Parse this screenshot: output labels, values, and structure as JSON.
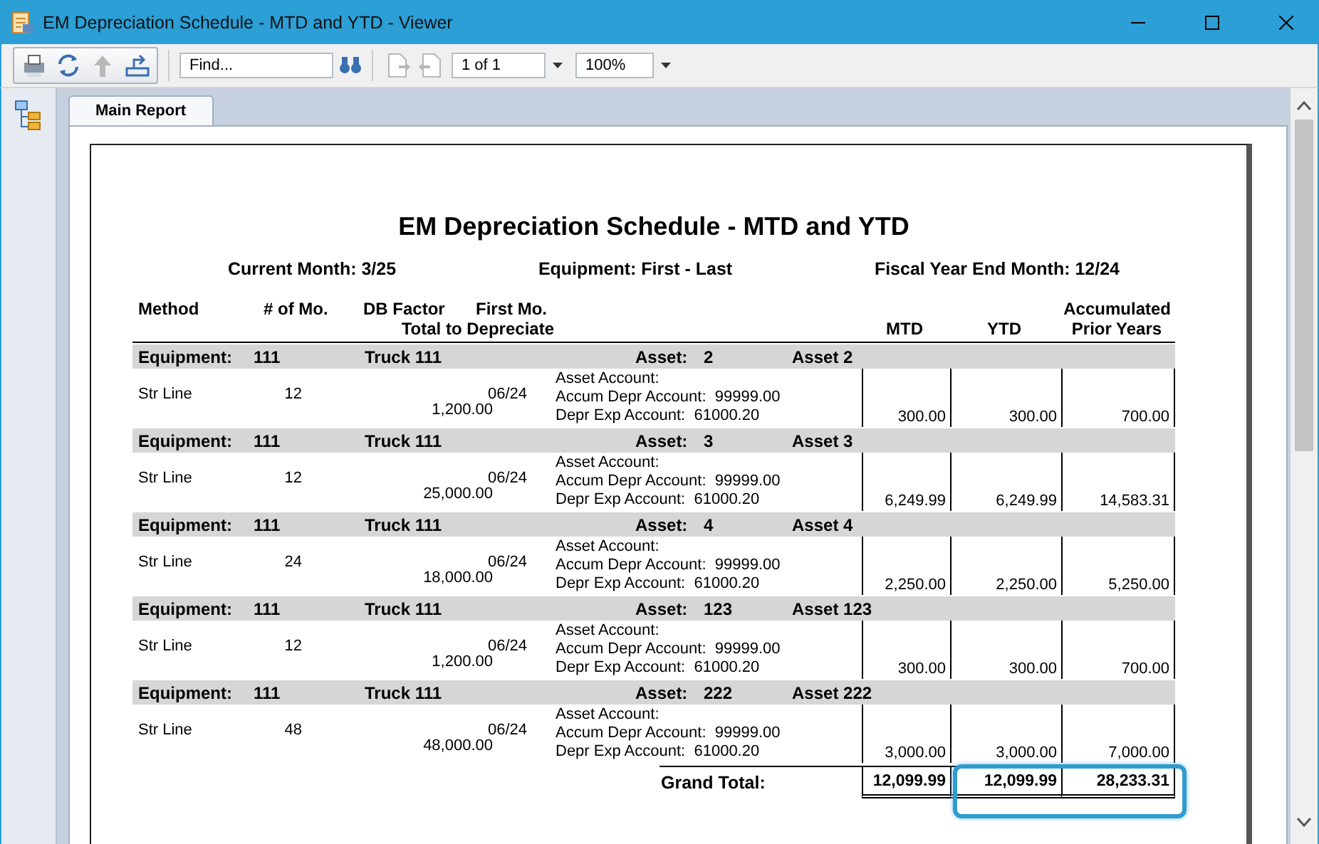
{
  "window": {
    "title": "EM Depreciation Schedule - MTD and YTD - Viewer"
  },
  "toolbar": {
    "buttons": [
      {
        "kind": "print",
        "disabled": false
      },
      {
        "kind": "refresh",
        "disabled": false
      },
      {
        "kind": "up",
        "disabled": true
      },
      {
        "kind": "export",
        "disabled": false
      }
    ],
    "find": {
      "placeholder": "Find..."
    },
    "nav_buttons": [
      {
        "kind": "next",
        "disabled": true
      },
      {
        "kind": "prev",
        "disabled": true
      }
    ],
    "page": "1 of 1",
    "zoom": "100%"
  },
  "tabs": [
    {
      "label": "Main Report",
      "selected": true
    }
  ],
  "report": {
    "title": "EM Depreciation Schedule - MTD and YTD",
    "params": [
      "Current Month: 3/25",
      "Equipment: First  -  Last",
      "Fiscal Year End Month: 12/24"
    ],
    "headers": {
      "method": "Method",
      "months": "# of Mo.",
      "db_factor": "DB Factor",
      "first_mo": "First Mo.",
      "total": "Total to Depreciate",
      "mtd": "MTD",
      "ytd": "YTD",
      "prior_top": "Accumulated",
      "prior_bottom": "Prior Years"
    },
    "groups": [
      {
        "equipment_label": "Equipment:",
        "equipment": "111",
        "description": "Truck 111",
        "asset_label": "Asset:",
        "asset": "2",
        "asset_description": "Asset 2",
        "method": "Str Line",
        "months": "12",
        "first_mo": "06/24",
        "total": "1,200.00",
        "accounts": [
          "Asset Account:",
          "Accum Depr Account:  99999.00",
          "Depr Exp Account:  61000.20"
        ],
        "mtd": "300.00",
        "ytd": "300.00",
        "prior": "700.00"
      },
      {
        "equipment_label": "Equipment:",
        "equipment": "111",
        "description": "Truck 111",
        "asset_label": "Asset:",
        "asset": "3",
        "asset_description": "Asset 3",
        "method": "Str Line",
        "months": "12",
        "first_mo": "06/24",
        "total": "25,000.00",
        "accounts": [
          "Asset Account:",
          "Accum Depr Account:  99999.00",
          "Depr Exp Account:  61000.20"
        ],
        "mtd": "6,249.99",
        "ytd": "6,249.99",
        "prior": "14,583.31"
      },
      {
        "equipment_label": "Equipment:",
        "equipment": "111",
        "description": "Truck 111",
        "asset_label": "Asset:",
        "asset": "4",
        "asset_description": "Asset 4",
        "method": "Str Line",
        "months": "24",
        "first_mo": "06/24",
        "total": "18,000.00",
        "accounts": [
          "Asset Account:",
          "Accum Depr Account:  99999.00",
          "Depr Exp Account:  61000.20"
        ],
        "mtd": "2,250.00",
        "ytd": "2,250.00",
        "prior": "5,250.00"
      },
      {
        "equipment_label": "Equipment:",
        "equipment": "111",
        "description": "Truck 111",
        "asset_label": "Asset:",
        "asset": "123",
        "asset_description": "Asset 123",
        "method": "Str Line",
        "months": "12",
        "first_mo": "06/24",
        "total": "1,200.00",
        "accounts": [
          "Asset Account:",
          "Accum Depr Account:  99999.00",
          "Depr Exp Account:  61000.20"
        ],
        "mtd": "300.00",
        "ytd": "300.00",
        "prior": "700.00"
      },
      {
        "equipment_label": "Equipment:",
        "equipment": "111",
        "description": "Truck 111",
        "asset_label": "Asset:",
        "asset": "222",
        "asset_description": "Asset 222",
        "method": "Str Line",
        "months": "48",
        "first_mo": "06/24",
        "total": "48,000.00",
        "accounts": [
          "Asset Account:",
          "Accum Depr Account:  99999.00",
          "Depr Exp Account:  61000.20"
        ],
        "mtd": "3,000.00",
        "ytd": "3,000.00",
        "prior": "7,000.00"
      }
    ],
    "grand_total": {
      "label": "Grand Total:",
      "values": [
        {
          "value": "12,099.99",
          "highlighted": false
        },
        {
          "value": "12,099.99",
          "highlighted": true
        },
        {
          "value": "28,233.31",
          "highlighted": true
        }
      ]
    }
  }
}
